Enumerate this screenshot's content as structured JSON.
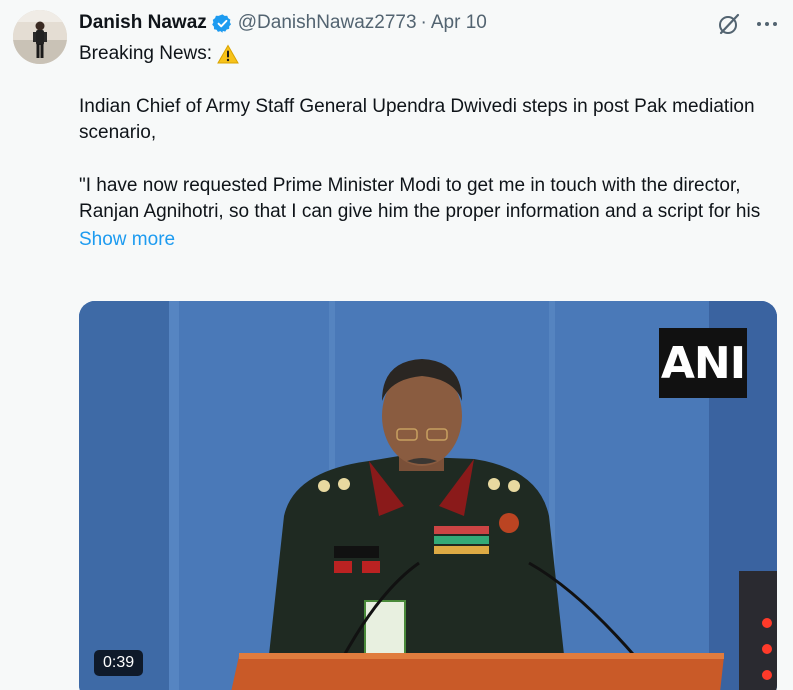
{
  "author": {
    "display_name": "Danish Nawaz",
    "handle": "@DanishNawaz2773",
    "separator": "·",
    "date": "Apr 10",
    "verified": true
  },
  "tweet": {
    "heading": "Breaking News:",
    "heading_icon": "warning-icon",
    "paragraph_1": "Indian Chief of Army Staff General Upendra Dwivedi steps in post Pak mediation scenario,",
    "paragraph_2": "\"I have now requested Prime Minister Modi to get me in touch with the director, Ranjan Agnihotri, so that I can give him the proper information and a script for his",
    "show_more": "Show more"
  },
  "media": {
    "watermark": "ANI",
    "duration": "0:39"
  },
  "icons": {
    "grok": "grok-icon",
    "more": "more-icon",
    "verified": "verified-badge-icon"
  },
  "colors": {
    "accent": "#1d9bf0",
    "secondary_text": "#536471",
    "background": "#f7f9f9"
  }
}
